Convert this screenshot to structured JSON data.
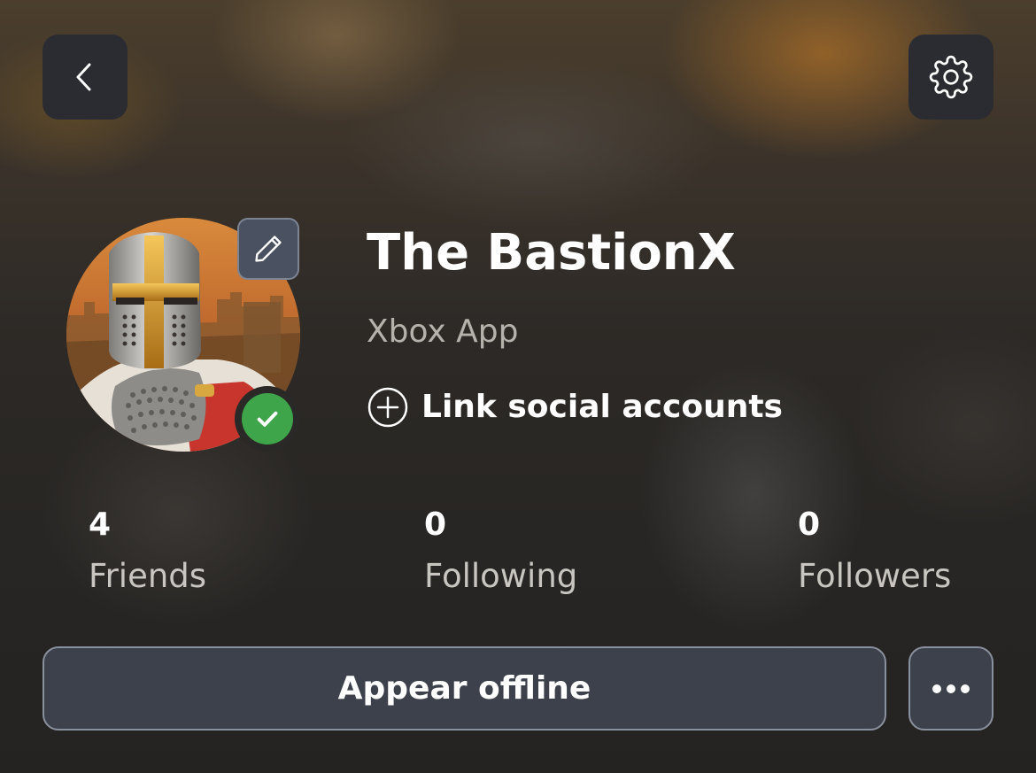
{
  "header": {
    "back_icon": "chevron-left-icon",
    "settings_icon": "gear-icon"
  },
  "profile": {
    "gamertag": "The BastionX",
    "subtitle": "Xbox App",
    "link_social_label": "Link social accounts",
    "link_social_icon": "plus-circle-icon",
    "avatar_description": "crusader-knight-avatar",
    "edit_icon": "pencil-icon",
    "status": "online",
    "status_color": "#3fa54a"
  },
  "stats": [
    {
      "value": "4",
      "label": "Friends"
    },
    {
      "value": "0",
      "label": "Following"
    },
    {
      "value": "0",
      "label": "Followers"
    }
  ],
  "actions": {
    "appear_offline_label": "Appear offline",
    "more_icon": "ellipsis-icon"
  }
}
